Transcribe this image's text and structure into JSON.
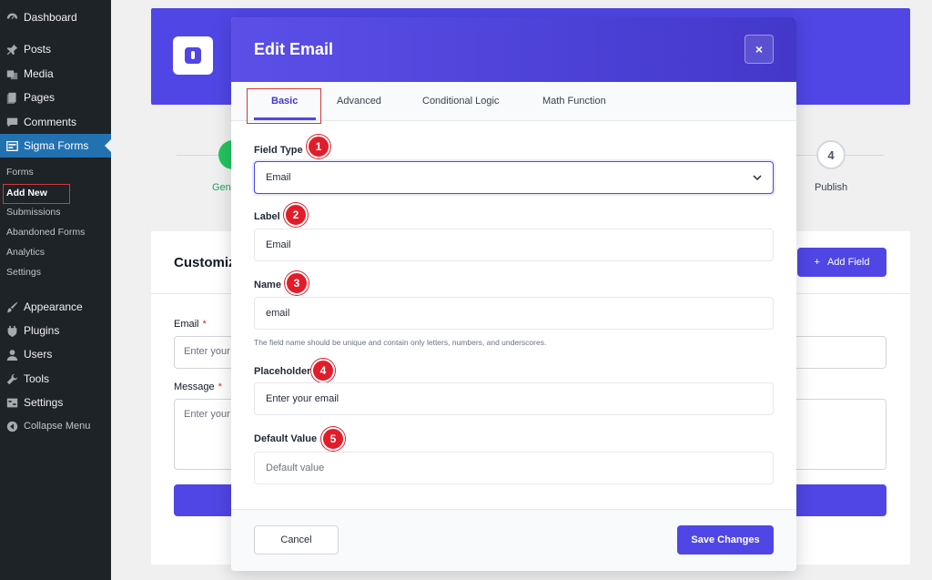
{
  "sidebar": {
    "items": [
      {
        "label": "Dashboard",
        "icon": "dashboard-icon"
      },
      {
        "label": "Posts",
        "icon": "pin-icon"
      },
      {
        "label": "Media",
        "icon": "media-icon"
      },
      {
        "label": "Pages",
        "icon": "pages-icon"
      },
      {
        "label": "Comments",
        "icon": "comment-icon"
      },
      {
        "label": "Sigma Forms",
        "icon": "form-icon"
      },
      {
        "label": "Appearance",
        "icon": "brush-icon"
      },
      {
        "label": "Plugins",
        "icon": "plugin-icon"
      },
      {
        "label": "Users",
        "icon": "user-icon"
      },
      {
        "label": "Tools",
        "icon": "wrench-icon"
      },
      {
        "label": "Settings",
        "icon": "settings-icon"
      },
      {
        "label": "Collapse Menu",
        "icon": "collapse-icon"
      }
    ],
    "submenu": [
      "Forms",
      "Add New",
      "Submissions",
      "Abandoned Forms",
      "Analytics",
      "Settings"
    ]
  },
  "background": {
    "step_label_partial": "Gen",
    "step4_number": "4",
    "step4_label": "Publish",
    "title_partial": "Customiz",
    "add_field": "Add Field",
    "email_label": "Email",
    "email_placeholder": "Enter your",
    "message_label": "Message",
    "message_placeholder": "Enter your",
    "required_mark": "*"
  },
  "modal": {
    "title": "Edit Email",
    "close": "×",
    "tabs": [
      "Basic",
      "Advanced",
      "Conditional Logic",
      "Math Function"
    ],
    "fields": {
      "field_type": {
        "label": "Field Type",
        "badge": "1",
        "value": "Email"
      },
      "label": {
        "label": "Label",
        "badge": "2",
        "value": "Email"
      },
      "name": {
        "label": "Name",
        "badge": "3",
        "value": "email",
        "help": "The field name should be unique and contain only letters, numbers, and underscores."
      },
      "placeholder": {
        "label": "Placeholder",
        "badge": "4",
        "value": "Enter your email"
      },
      "default_value": {
        "label": "Default Value",
        "badge": "5",
        "placeholder": "Default value"
      }
    },
    "cancel": "Cancel",
    "save": "Save Changes"
  },
  "colors": {
    "accent": "#4f46e5",
    "sidebar_bg": "#1d2327",
    "sidebar_active": "#2271b1",
    "badge": "#e11d2a",
    "highlight_box": "#d63638"
  }
}
